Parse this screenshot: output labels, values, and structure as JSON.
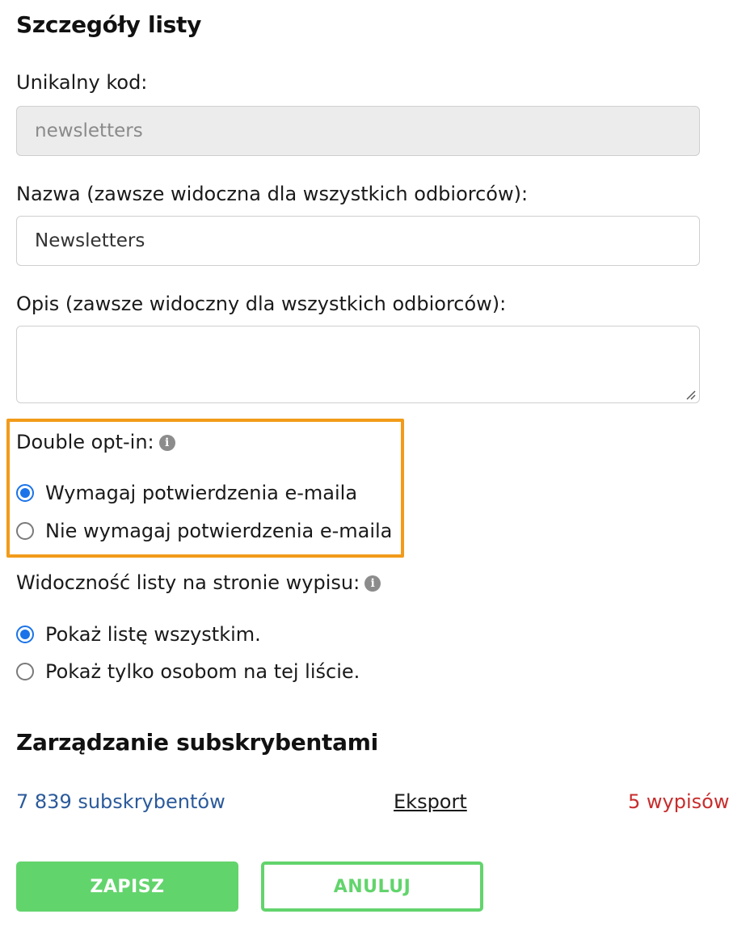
{
  "details": {
    "title": "Szczegóły listy",
    "code_label": "Unikalny kod:",
    "code_value": "newsletters",
    "name_label": "Nazwa (zawsze widoczna dla wszystkich odbiorców):",
    "name_value": "Newsletters",
    "description_label": "Opis (zawsze widoczny dla wszystkich odbiorców):",
    "description_value": ""
  },
  "double_opt_in": {
    "label": "Double opt-in:",
    "options": [
      {
        "label": "Wymagaj potwierdzenia e-maila",
        "checked": true
      },
      {
        "label": "Nie wymagaj potwierdzenia e-maila",
        "checked": false
      }
    ],
    "highlight_color": "#f29b1a"
  },
  "visibility": {
    "label": "Widoczność listy na stronie wypisu:",
    "options": [
      {
        "label": "Pokaż listę wszystkim.",
        "checked": true
      },
      {
        "label": "Pokaż tylko osobom na tej liście.",
        "checked": false
      }
    ]
  },
  "subscribers": {
    "title": "Zarządzanie subskrybentami",
    "count_link": "7 839 subskrybentów",
    "export_link": "Eksport",
    "unsubscribes_link": "5 wypisów"
  },
  "actions": {
    "save_label": "ZAPISZ",
    "cancel_label": "ANULUJ"
  },
  "icons": {
    "info": "info-icon",
    "info_glyph": "i"
  },
  "colors": {
    "accent": "#62d46c",
    "radio_checked": "#1a73e8",
    "link": "#2b5a9b",
    "danger": "#c72d2d"
  }
}
